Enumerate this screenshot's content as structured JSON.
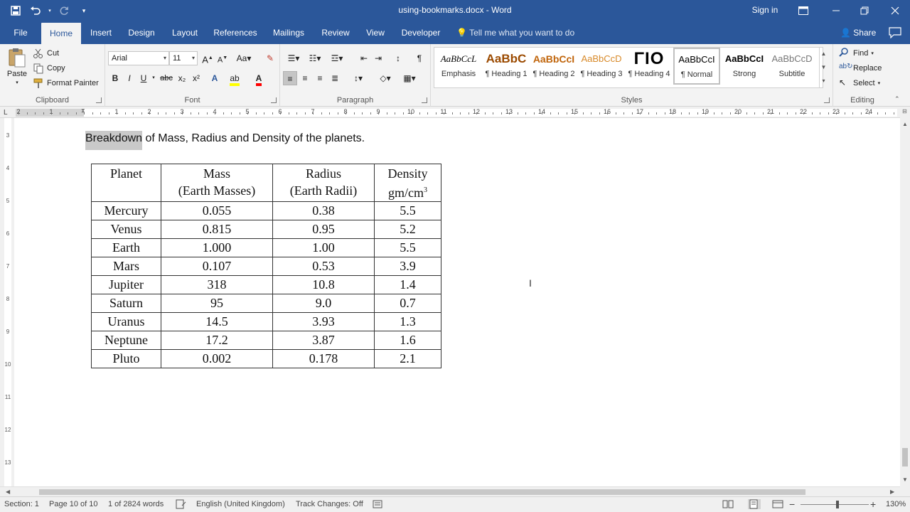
{
  "window": {
    "title": "using-bookmarks.docx - Word",
    "sign_in": "Sign in"
  },
  "quick_access": {
    "save_icon": "save-icon",
    "undo_icon": "undo-icon",
    "redo_icon": "redo-icon",
    "customize_icon": "customize-icon"
  },
  "tabs": [
    {
      "label": "File"
    },
    {
      "label": "Home"
    },
    {
      "label": "Insert"
    },
    {
      "label": "Design"
    },
    {
      "label": "Layout"
    },
    {
      "label": "References"
    },
    {
      "label": "Mailings"
    },
    {
      "label": "Review"
    },
    {
      "label": "View"
    },
    {
      "label": "Developer"
    }
  ],
  "tell_me": "Tell me what you want to do",
  "share_label": "Share",
  "clipboard": {
    "paste": "Paste",
    "cut": "Cut",
    "copy": "Copy",
    "format_painter": "Format Painter",
    "label": "Clipboard"
  },
  "font": {
    "name": "Arial",
    "size": "11",
    "bold": "B",
    "italic": "I",
    "underline": "U",
    "strike": "abc",
    "subscript": "x₂",
    "superscript": "x²",
    "label": "Font"
  },
  "paragraph": {
    "label": "Paragraph"
  },
  "styles": {
    "label": "Styles",
    "items": [
      {
        "preview": "AaBbCcL",
        "name": "Emphasis"
      },
      {
        "preview": "AaBbC",
        "name": "¶ Heading 1"
      },
      {
        "preview": "AaBbCcI",
        "name": "¶ Heading 2"
      },
      {
        "preview": "AaBbCcD",
        "name": "¶ Heading 3"
      },
      {
        "preview": "ΓΙΟ",
        "name": "¶ Heading 4"
      },
      {
        "preview": "AaBbCcI",
        "name": "¶ Normal"
      },
      {
        "preview": "AaBbCcI",
        "name": "Strong"
      },
      {
        "preview": "AaBbCcD",
        "name": "Subtitle"
      }
    ]
  },
  "editing": {
    "find": "Find",
    "replace": "Replace",
    "select": "Select",
    "label": "Editing"
  },
  "ruler": {
    "numbers": [
      "2",
      "1",
      "1",
      "2",
      "3",
      "4",
      "5",
      "6",
      "7",
      "8",
      "9",
      "10",
      "11",
      "12",
      "13",
      "14",
      "15",
      "16",
      "17",
      "18",
      "19",
      "20",
      "21",
      "22",
      "23",
      "24"
    ]
  },
  "vruler": {
    "numbers": [
      "3",
      "4",
      "5",
      "6",
      "7",
      "8",
      "9",
      "10",
      "11",
      "12",
      "13"
    ]
  },
  "document": {
    "highlighted_word": "Breakdown",
    "sentence_rest": " of Mass, Radius and Density of the planets.",
    "table": {
      "headers": [
        {
          "line1": "Planet",
          "line2": ""
        },
        {
          "line1": "Mass",
          "line2": "(Earth Masses)"
        },
        {
          "line1": "Radius",
          "line2": "(Earth Radii)"
        },
        {
          "line1": "Density",
          "line2": "gm/cm",
          "sup": "3"
        }
      ],
      "rows": [
        [
          "Mercury",
          "0.055",
          "0.38",
          "5.5"
        ],
        [
          "Venus",
          "0.815",
          "0.95",
          "5.2"
        ],
        [
          "Earth",
          "1.000",
          "1.00",
          "5.5"
        ],
        [
          "Mars",
          "0.107",
          "0.53",
          "3.9"
        ],
        [
          "Jupiter",
          "318",
          "10.8",
          "1.4"
        ],
        [
          "Saturn",
          "95",
          "9.0",
          "0.7"
        ],
        [
          "Uranus",
          "14.5",
          "3.93",
          "1.3"
        ],
        [
          "Neptune",
          "17.2",
          "3.87",
          "1.6"
        ],
        [
          "Pluto",
          "0.002",
          "0.178",
          "2.1"
        ]
      ]
    }
  },
  "status": {
    "section": "Section: 1",
    "page": "Page 10 of 10",
    "words": "1 of 2824 words",
    "language": "English (United Kingdom)",
    "track_changes": "Track Changes: Off",
    "zoom": "130%"
  },
  "colors": {
    "accent": "#2b579a"
  }
}
